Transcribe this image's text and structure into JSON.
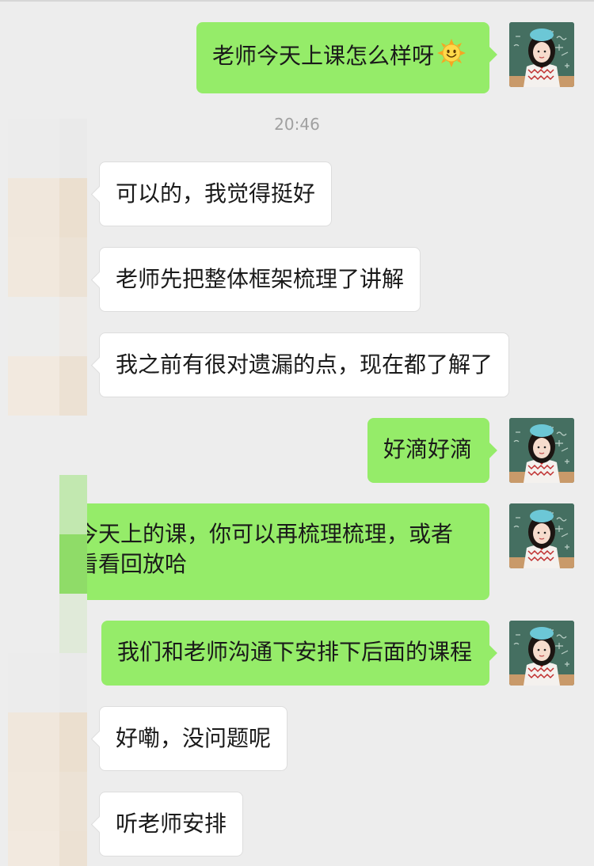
{
  "chat": {
    "timestamp": "20:46",
    "messages": [
      {
        "side": "out",
        "text": "老师今天上课怎么样呀",
        "emoji": "sun-smile"
      },
      {
        "side": "in",
        "text": "可以的，我觉得挺好"
      },
      {
        "side": "in",
        "text": "老师先把整体框架梳理了讲解"
      },
      {
        "side": "in",
        "text": "我之前有很对遗漏的点，现在都了解了"
      },
      {
        "side": "out",
        "text": "好滴好滴"
      },
      {
        "side": "out",
        "lines": [
          "今天上的课，你可以再梳理梳理，或者",
          "看看回放哈"
        ]
      },
      {
        "side": "out",
        "text": "我们和老师沟通下安排下后面的课程"
      },
      {
        "side": "in",
        "text": "好嘞，没问题呢"
      },
      {
        "side": "in",
        "text": "听老师安排"
      }
    ]
  },
  "colors": {
    "background": "#ededed",
    "out_bubble": "#95ec69",
    "in_bubble": "#ffffff",
    "text": "#1a1a1a",
    "timestamp": "#a0a0a0"
  },
  "icons": {
    "emoji": "sun-smile-emoji",
    "avatar": "teacher-avatar",
    "pixelated": "blurred-contact-avatar"
  }
}
